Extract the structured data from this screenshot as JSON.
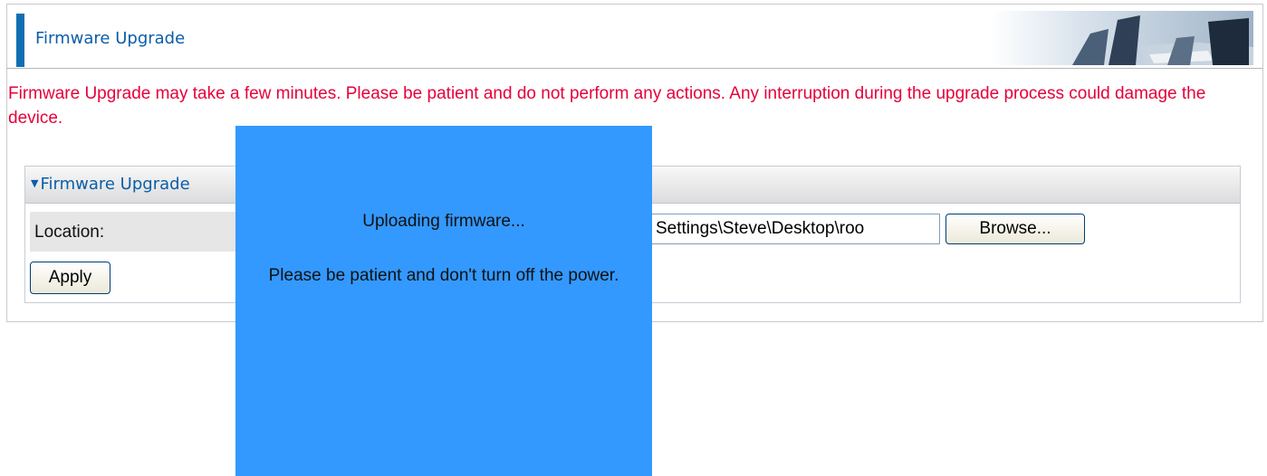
{
  "header": {
    "title": "Firmware Upgrade"
  },
  "warning": {
    "text": "Firmware Upgrade may take a few minutes. Please be patient and do not perform any actions. Any interruption during the upgrade process could damage the device."
  },
  "section": {
    "title": "Firmware Upgrade",
    "location_label": "Location:",
    "file_value": "Settings\\Steve\\Desktop\\roo",
    "browse_label": "Browse...",
    "apply_label": "Apply"
  },
  "modal": {
    "line1": "Uploading firmware...",
    "line2": "Please be patient and don't turn off the power."
  },
  "colors": {
    "accent": "#0e6fb3",
    "title_text": "#0a5ea8",
    "warning_text": "#e6003a",
    "modal_bg": "#3399ff"
  },
  "icons": {
    "section_toggle": "caret-down-icon",
    "header_art": "office-chairs-banner"
  }
}
